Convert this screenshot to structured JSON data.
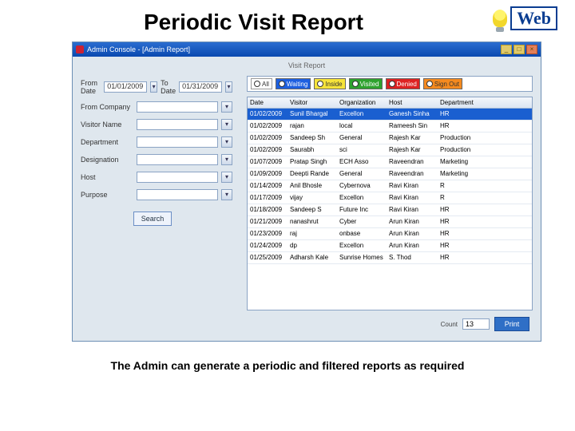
{
  "slide": {
    "title": "Periodic Visit Report",
    "caption": "The Admin can generate a periodic and filtered reports as required",
    "logo_text": "Web"
  },
  "window": {
    "title": "Admin Console - [Admin Report]",
    "inner_title": "Visit Report"
  },
  "filters": {
    "from_label": "From Date",
    "from_value": "01/01/2009",
    "to_label": "To Date",
    "to_value": "01/31/2009",
    "company_label": "From Company",
    "visitor_label": "Visitor Name",
    "dept_label": "Department",
    "desig_label": "Designation",
    "host_label": "Host",
    "purpose_label": "Purpose",
    "search_label": "Search"
  },
  "status": {
    "all": "All",
    "waiting": "Waiting",
    "inside": "Inside",
    "visited": "Visited",
    "denied": "Denied",
    "signout": "Sign Out"
  },
  "grid": {
    "headers": [
      "Date",
      "Visitor",
      "Organization",
      "Host",
      "Department"
    ],
    "rows": [
      [
        "01/02/2009",
        "Sunil Bhargal",
        "Excellon",
        "Ganesh Sinha",
        "HR"
      ],
      [
        "01/02/2009",
        "rajan",
        "local",
        "Rameesh Sin",
        "HR"
      ],
      [
        "01/02/2009",
        "Sandeep Sh",
        "General",
        "Rajesh Kar",
        "Production"
      ],
      [
        "01/02/2009",
        "Saurabh",
        "sci",
        "Rajesh Kar",
        "Production"
      ],
      [
        "01/07/2009",
        "Pratap Singh",
        "ECH Asso",
        "Raveendran",
        "Marketing"
      ],
      [
        "01/09/2009",
        "Deepti Rande",
        "General",
        "Raveendran",
        "Marketing"
      ],
      [
        "01/14/2009",
        "Anil Bhosle",
        "Cybernova",
        "Ravi Kiran",
        "R"
      ],
      [
        "01/17/2009",
        "vijay",
        "Excellon",
        "Ravi Kiran",
        "R"
      ],
      [
        "01/18/2009",
        "Sandeep S",
        "Future Inc",
        "Ravi Kiran",
        "HR"
      ],
      [
        "01/21/2009",
        "nanashrut",
        "Cyber",
        "Arun Kiran",
        "HR"
      ],
      [
        "01/23/2009",
        "raj",
        "onbase",
        "Arun Kiran",
        "HR"
      ],
      [
        "01/24/2009",
        "dp",
        "Excellon",
        "Arun Kiran",
        "HR"
      ],
      [
        "01/25/2009",
        "Adharsh Kale",
        "Sunrise Homes",
        "S. Thod",
        "HR"
      ]
    ]
  },
  "footer": {
    "count_label": "Count",
    "count_value": "13",
    "print_label": "Print"
  }
}
